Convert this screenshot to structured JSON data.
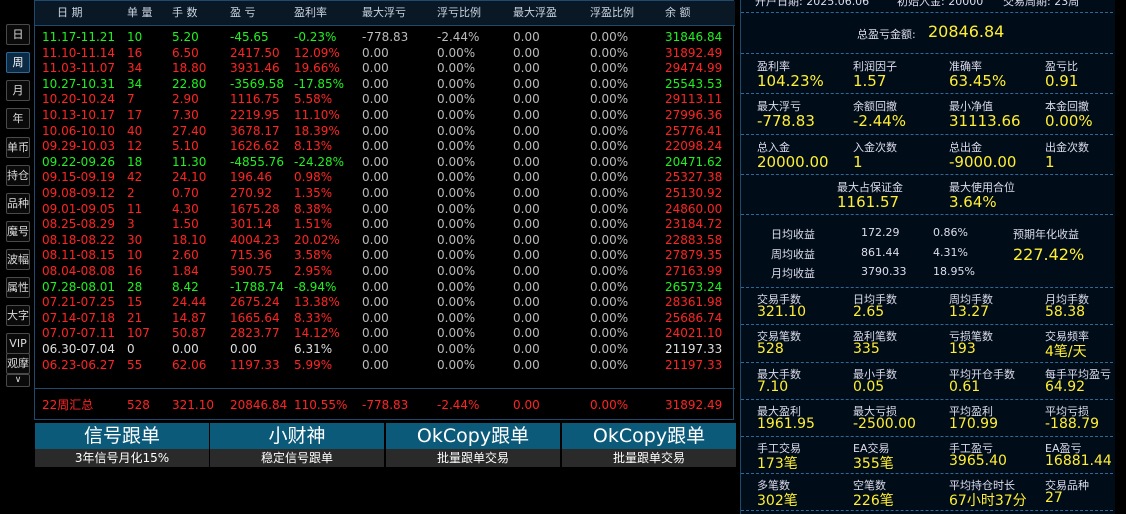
{
  "sidebar": {
    "buttons": [
      {
        "label": "日",
        "active": false
      },
      {
        "label": "周",
        "active": true
      },
      {
        "label": "月",
        "active": false
      },
      {
        "label": "年",
        "active": false
      },
      {
        "label": "单币",
        "active": false
      },
      {
        "label": "持仓",
        "active": false
      },
      {
        "label": "品种",
        "active": false
      },
      {
        "label": "魔号",
        "active": false
      },
      {
        "label": "波幅",
        "active": false
      },
      {
        "label": "属性",
        "active": false
      },
      {
        "label": "大字",
        "active": false
      },
      {
        "label": "VIP",
        "active": false
      },
      {
        "label": "观摩",
        "active": false
      }
    ],
    "expand_icon": "∨"
  },
  "table": {
    "headers": [
      "日 期",
      "单 量",
      "手 数",
      "盈 亏",
      "盈利率",
      "最大浮亏",
      "浮亏比例",
      "最大浮盈",
      "浮盈比例",
      "余 额"
    ],
    "rows": [
      {
        "color": "green",
        "cells": [
          "11.17-11.21",
          "10",
          "5.20",
          "-45.65",
          "-0.23%",
          "-778.83",
          "-2.44%",
          "0.00",
          "0.00%",
          "31846.84"
        ]
      },
      {
        "color": "red",
        "cells": [
          "11.10-11.14",
          "16",
          "6.50",
          "2417.50",
          "12.09%",
          "0.00",
          "0.00%",
          "0.00",
          "0.00%",
          "31892.49"
        ]
      },
      {
        "color": "red",
        "cells": [
          "11.03-11.07",
          "34",
          "18.80",
          "3931.46",
          "19.66%",
          "0.00",
          "0.00%",
          "0.00",
          "0.00%",
          "29474.99"
        ]
      },
      {
        "color": "green",
        "cells": [
          "10.27-10.31",
          "34",
          "22.80",
          "-3569.58",
          "-17.85%",
          "0.00",
          "0.00%",
          "0.00",
          "0.00%",
          "25543.53"
        ]
      },
      {
        "color": "red",
        "cells": [
          "10.20-10.24",
          "7",
          "2.90",
          "1116.75",
          "5.58%",
          "0.00",
          "0.00%",
          "0.00",
          "0.00%",
          "29113.11"
        ]
      },
      {
        "color": "red",
        "cells": [
          "10.13-10.17",
          "17",
          "7.30",
          "2219.95",
          "11.10%",
          "0.00",
          "0.00%",
          "0.00",
          "0.00%",
          "27996.36"
        ]
      },
      {
        "color": "red",
        "cells": [
          "10.06-10.10",
          "40",
          "27.40",
          "3678.17",
          "18.39%",
          "0.00",
          "0.00%",
          "0.00",
          "0.00%",
          "25776.41"
        ]
      },
      {
        "color": "red",
        "cells": [
          "09.29-10.03",
          "12",
          "5.10",
          "1626.62",
          "8.13%",
          "0.00",
          "0.00%",
          "0.00",
          "0.00%",
          "22098.24"
        ]
      },
      {
        "color": "green",
        "cells": [
          "09.22-09.26",
          "18",
          "11.30",
          "-4855.76",
          "-24.28%",
          "0.00",
          "0.00%",
          "0.00",
          "0.00%",
          "20471.62"
        ]
      },
      {
        "color": "red",
        "cells": [
          "09.15-09.19",
          "42",
          "24.10",
          "196.46",
          "0.98%",
          "0.00",
          "0.00%",
          "0.00",
          "0.00%",
          "25327.38"
        ]
      },
      {
        "color": "red",
        "cells": [
          "09.08-09.12",
          "2",
          "0.70",
          "270.92",
          "1.35%",
          "0.00",
          "0.00%",
          "0.00",
          "0.00%",
          "25130.92"
        ]
      },
      {
        "color": "red",
        "cells": [
          "09.01-09.05",
          "11",
          "4.30",
          "1675.28",
          "8.38%",
          "0.00",
          "0.00%",
          "0.00",
          "0.00%",
          "24860.00"
        ]
      },
      {
        "color": "red",
        "cells": [
          "08.25-08.29",
          "3",
          "1.50",
          "301.14",
          "1.51%",
          "0.00",
          "0.00%",
          "0.00",
          "0.00%",
          "23184.72"
        ]
      },
      {
        "color": "red",
        "cells": [
          "08.18-08.22",
          "30",
          "18.10",
          "4004.23",
          "20.02%",
          "0.00",
          "0.00%",
          "0.00",
          "0.00%",
          "22883.58"
        ]
      },
      {
        "color": "red",
        "cells": [
          "08.11-08.15",
          "10",
          "2.60",
          "715.36",
          "3.58%",
          "0.00",
          "0.00%",
          "0.00",
          "0.00%",
          "27879.35"
        ]
      },
      {
        "color": "red",
        "cells": [
          "08.04-08.08",
          "16",
          "1.84",
          "590.75",
          "2.95%",
          "0.00",
          "0.00%",
          "0.00",
          "0.00%",
          "27163.99"
        ]
      },
      {
        "color": "green",
        "cells": [
          "07.28-08.01",
          "28",
          "8.42",
          "-1788.74",
          "-8.94%",
          "0.00",
          "0.00%",
          "0.00",
          "0.00%",
          "26573.24"
        ]
      },
      {
        "color": "red",
        "cells": [
          "07.21-07.25",
          "15",
          "24.44",
          "2675.24",
          "13.38%",
          "0.00",
          "0.00%",
          "0.00",
          "0.00%",
          "28361.98"
        ]
      },
      {
        "color": "red",
        "cells": [
          "07.14-07.18",
          "21",
          "14.87",
          "1665.64",
          "8.33%",
          "0.00",
          "0.00%",
          "0.00",
          "0.00%",
          "25686.74"
        ]
      },
      {
        "color": "red",
        "cells": [
          "07.07-07.11",
          "107",
          "50.87",
          "2823.77",
          "14.12%",
          "0.00",
          "0.00%",
          "0.00",
          "0.00%",
          "24021.10"
        ]
      },
      {
        "color": "white",
        "cells": [
          "06.30-07.04",
          "0",
          "0.00",
          "0.00",
          "6.31%",
          "0.00",
          "0.00%",
          "0.00",
          "0.00%",
          "21197.33"
        ]
      },
      {
        "color": "red",
        "cells": [
          "06.23-06.27",
          "55",
          "62.06",
          "1197.33",
          "5.99%",
          "0.00",
          "0.00%",
          "0.00",
          "0.00%",
          "21197.33"
        ]
      }
    ],
    "summary": [
      "22周汇总",
      "528",
      "321.10",
      "20846.84",
      "110.55%",
      "-778.83",
      "-2.44%",
      "0.00",
      "0.00%",
      "31892.49"
    ]
  },
  "ads": [
    {
      "title": "信号跟单",
      "sub": "3年信号月化15%"
    },
    {
      "title": "小财神",
      "sub": "稳定信号跟单"
    },
    {
      "title": "OkCopy跟单",
      "sub": "批量跟单交易"
    },
    {
      "title": "OkCopy跟单",
      "sub": "批量跟单交易"
    }
  ],
  "panel": {
    "top_fragments": [
      "开户日期: 2025.06.06",
      "初始入金: 20000",
      "交易周期: 23周"
    ],
    "total_pl_label": "总盈亏金额:",
    "total_pl_value": "20846.84",
    "r1": [
      {
        "l": "盈利率",
        "v": "104.23%"
      },
      {
        "l": "利润因子",
        "v": "1.57"
      },
      {
        "l": "准确率",
        "v": "63.45%"
      },
      {
        "l": "盈亏比",
        "v": "0.91"
      }
    ],
    "r2": [
      {
        "l": "最大浮亏",
        "v": "-778.83"
      },
      {
        "l": "余额回撤",
        "v": "-2.44%"
      },
      {
        "l": "最小净值",
        "v": "31113.66"
      },
      {
        "l": "本金回撤",
        "v": "0.00%"
      }
    ],
    "r3": [
      {
        "l": "总入金",
        "v": "20000.00"
      },
      {
        "l": "入金次数",
        "v": "1"
      },
      {
        "l": "总出金",
        "v": "-9000.00"
      },
      {
        "l": "出金次数",
        "v": "1"
      }
    ],
    "r4": [
      {
        "l": "最大占保证金",
        "v": "1161.57"
      },
      {
        "l": "最大使用合位",
        "v": "3.64%"
      }
    ],
    "avg": {
      "day_label": "日均收益",
      "day_val": "172.29",
      "day_pct": "0.86%",
      "week_label": "周均收益",
      "week_val": "861.44",
      "week_pct": "4.31%",
      "month_label": "月均收益",
      "month_val": "3790.33",
      "month_pct": "18.95%",
      "annual_label": "预期年化收益",
      "annual_val": "227.42%"
    },
    "r5": [
      {
        "l": "交易手数",
        "v": "321.10"
      },
      {
        "l": "日均手数",
        "v": "2.65"
      },
      {
        "l": "周均手数",
        "v": "13.27"
      },
      {
        "l": "月均手数",
        "v": "58.38"
      }
    ],
    "r6": [
      {
        "l": "交易笔数",
        "v": "528"
      },
      {
        "l": "盈利笔数",
        "v": "335"
      },
      {
        "l": "亏损笔数",
        "v": "193"
      },
      {
        "l": "交易频率",
        "v": "4笔/天"
      }
    ],
    "r7": [
      {
        "l": "最大手数",
        "v": "7.10"
      },
      {
        "l": "最小手数",
        "v": "0.05"
      },
      {
        "l": "平均开仓手数",
        "v": "0.61"
      },
      {
        "l": "每手平均盈亏",
        "v": "64.92"
      }
    ],
    "r8": [
      {
        "l": "最大盈利",
        "v": "1961.95"
      },
      {
        "l": "最大亏损",
        "v": "-2500.00"
      },
      {
        "l": "平均盈利",
        "v": "170.99"
      },
      {
        "l": "平均亏损",
        "v": "-188.79"
      }
    ],
    "r9": [
      {
        "l": "手工交易",
        "v": "173笔"
      },
      {
        "l": "EA交易",
        "v": "355笔"
      },
      {
        "l": "手工盈亏",
        "v": "3965.40"
      },
      {
        "l": "EA盈亏",
        "v": "16881.44"
      }
    ],
    "r10": [
      {
        "l": "多笔数",
        "v": "302笔"
      },
      {
        "l": "空笔数",
        "v": "226笔"
      },
      {
        "l": "平均持仓时长",
        "v": "67小时37分"
      },
      {
        "l": "交易品种",
        "v": "27"
      }
    ]
  }
}
